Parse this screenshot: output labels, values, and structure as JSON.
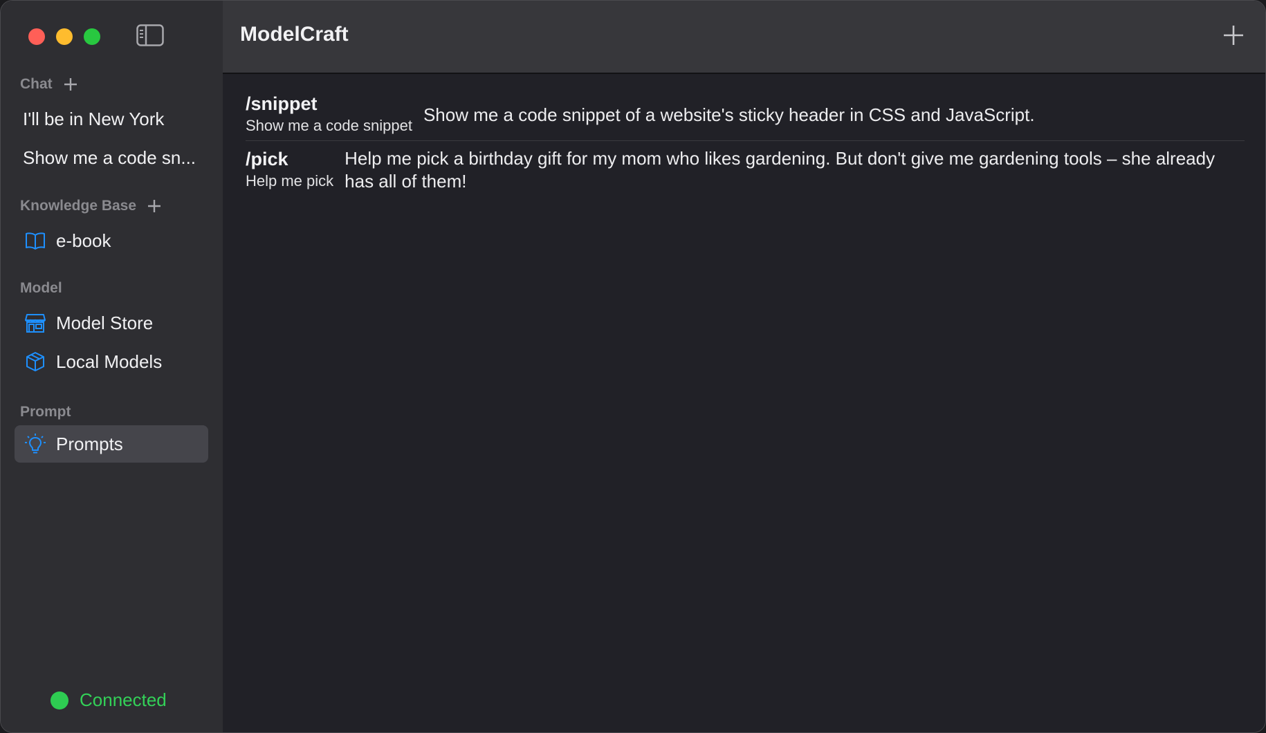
{
  "window": {
    "title": "ModelCraft"
  },
  "sidebar": {
    "chat_header": "Chat",
    "chats": [
      {
        "label": "I'll be in New York"
      },
      {
        "label": "Show me a code sn..."
      }
    ],
    "kb_header": "Knowledge Base",
    "kb_items": [
      {
        "label": "e-book",
        "icon": "book-icon"
      }
    ],
    "model_header": "Model",
    "model_items": [
      {
        "label": "Model Store",
        "icon": "store-icon"
      },
      {
        "label": "Local Models",
        "icon": "cube-icon"
      }
    ],
    "prompt_header": "Prompt",
    "prompt_items": [
      {
        "label": "Prompts",
        "icon": "lightbulb-icon",
        "selected": true
      }
    ],
    "status": {
      "label": "Connected",
      "color": "#33d158"
    }
  },
  "prompts": [
    {
      "command": "/snippet",
      "subtitle": "Show me a code snippet",
      "text": "Show me a code snippet of a website's sticky header in CSS and JavaScript."
    },
    {
      "command": "/pick",
      "subtitle": "Help me pick",
      "text": "Help me pick a birthday gift for my mom who likes gardening. But don't give me gardening tools – she already has all of them!"
    }
  ],
  "colors": {
    "accent": "#1e90ff",
    "sidebar_bg": "#2e2e32",
    "content_bg": "#212127"
  }
}
